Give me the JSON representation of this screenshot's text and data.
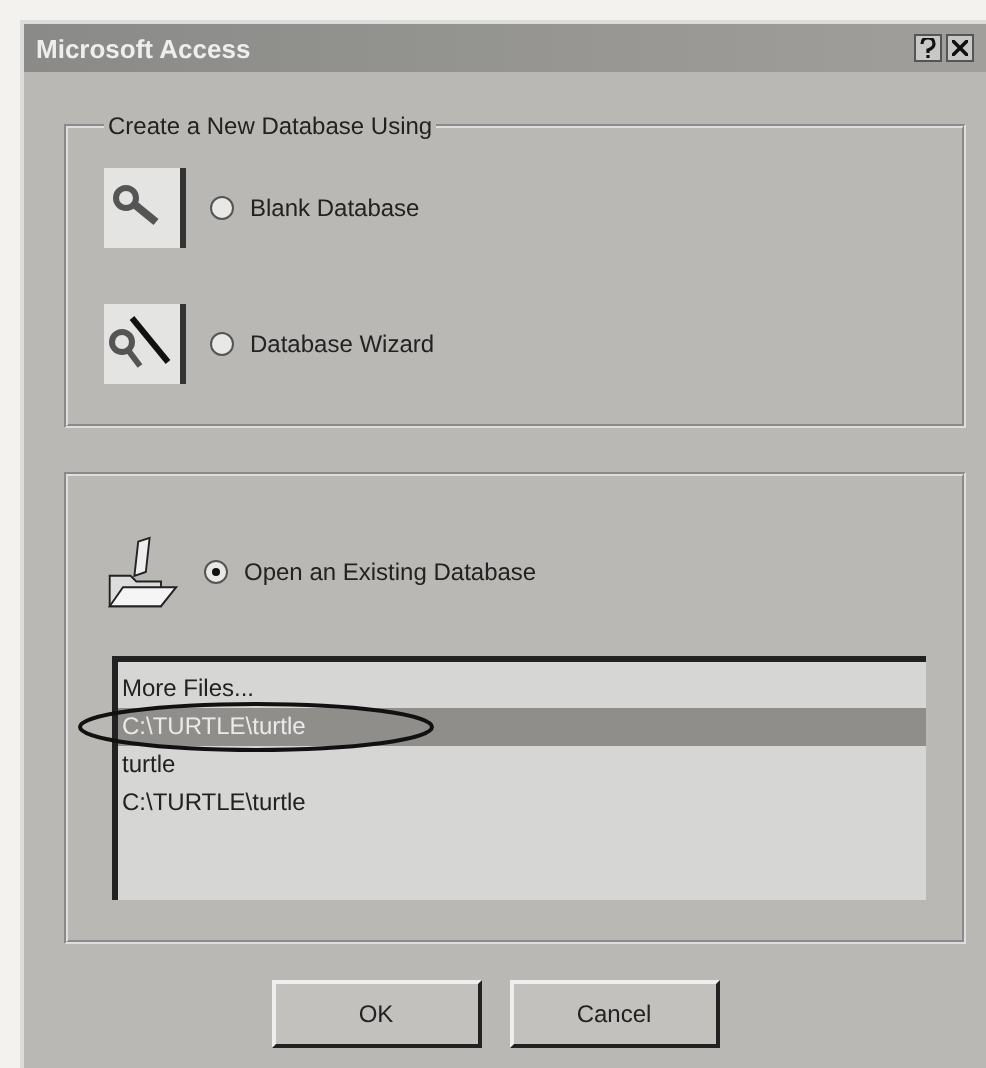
{
  "window": {
    "title": "Microsoft Access"
  },
  "create_group": {
    "title": "Create a New Database Using",
    "options": [
      {
        "kind": "blank",
        "label": "Blank Database",
        "selected": false
      },
      {
        "kind": "wizard",
        "label": "Database Wizard",
        "selected": false
      }
    ]
  },
  "open_group": {
    "option": {
      "label": "Open an Existing Database",
      "selected": true
    },
    "files": [
      {
        "label": "More Files...",
        "selected": false,
        "circled": false
      },
      {
        "label": "C:\\TURTLE\\turtle",
        "selected": true,
        "circled": true
      },
      {
        "label": "turtle",
        "selected": false,
        "circled": false
      },
      {
        "label": "C:\\TURTLE\\turtle",
        "selected": false,
        "circled": false
      }
    ]
  },
  "buttons": [
    {
      "label": "OK"
    },
    {
      "label": "Cancel"
    }
  ]
}
